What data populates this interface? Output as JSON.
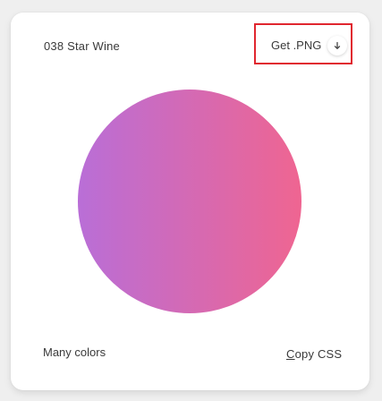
{
  "gradient": {
    "name": "038 Star Wine",
    "colors": [
      "#b96ed7",
      "#ef6591"
    ],
    "color_left": "#b96ed7",
    "color_right": "#ef6591"
  },
  "download": {
    "label": "Get .PNG",
    "icon": "arrow-down-icon"
  },
  "footer": {
    "note": "Many colors",
    "copy_first": "C",
    "copy_rest": "opy CSS"
  },
  "highlight_color": "#e0262f"
}
